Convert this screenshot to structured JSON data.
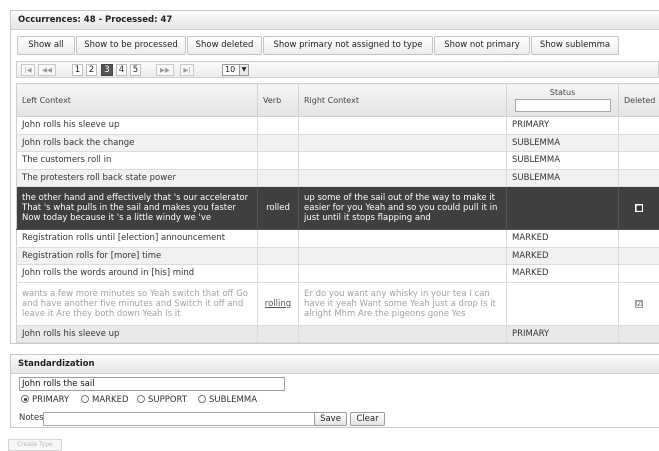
{
  "occurrences": {
    "header": "Occurrences: 48 - Processed: 47",
    "filters": [
      "Show all",
      "Show to be processed",
      "Show deleted",
      "Show primary not assigned to type",
      "Show not primary",
      "Show sublemma"
    ],
    "pager": {
      "first": "|◀",
      "prev": "◀◀",
      "pages": [
        "1",
        "2",
        "3",
        "4",
        "5"
      ],
      "current_page": "3",
      "next": "▶▶",
      "last": "▶|",
      "page_size": "10"
    },
    "columns": {
      "left": "Left Context",
      "verb": "Verb",
      "right": "Right Context",
      "status": "Status",
      "deleted": "Deleted"
    },
    "rows": [
      {
        "left": "John rolls his sleeve up",
        "verb": "",
        "right": "",
        "status": "PRIMARY",
        "deleted": ""
      },
      {
        "left": "John rolls back the change",
        "verb": "",
        "right": "",
        "status": "SUBLEMMA",
        "deleted": ""
      },
      {
        "left": "The customers roll in",
        "verb": "",
        "right": "",
        "status": "SUBLEMMA",
        "deleted": ""
      },
      {
        "left": "The protesters roll back state power",
        "verb": "",
        "right": "",
        "status": "SUBLEMMA",
        "deleted": ""
      },
      {
        "left": "the other hand and effectively that 's our accelerator That 's what pulls in the sail and makes you faster Now today because it 's a little windy we 've",
        "verb": "rolled",
        "right": "up some of the sail out of the way to make it easier for you Yeah and so you could pull it in just until it stops flapping and",
        "status": "",
        "deleted": "■"
      },
      {
        "left": "Registration rolls until [election] announcement",
        "verb": "",
        "right": "",
        "status": "MARKED",
        "deleted": ""
      },
      {
        "left": "Registration rolls for [more] time",
        "verb": "",
        "right": "",
        "status": "MARKED",
        "deleted": ""
      },
      {
        "left": "John rolls the words around in [his] mind",
        "verb": "",
        "right": "",
        "status": "MARKED",
        "deleted": ""
      },
      {
        "left": "wants a few more minutes so Yeah switch that off Go and have another five minutes and Switch it off and leave it Are they both down Yeah Is it",
        "verb": "rolling",
        "right": "Er do you want any whisky in your tea I can have it yeah Want some Yeah just a drop Is it alright Mhm Are the pigeons gone Yes",
        "status": "",
        "deleted": "☑"
      },
      {
        "left": "John rolls his sleeve up",
        "verb": "",
        "right": "",
        "status": "PRIMARY",
        "deleted": ""
      }
    ]
  },
  "standardization": {
    "header": "Standardization",
    "value": "John rolls the sail",
    "options": [
      "PRIMARY",
      "MARKED",
      "SUPPORT",
      "SUBLEMMA"
    ],
    "selected": "PRIMARY",
    "notes_label": "Notes",
    "notes_value": "",
    "save_label": "Save",
    "clear_label": "Clear"
  },
  "create_button": "Create Type"
}
